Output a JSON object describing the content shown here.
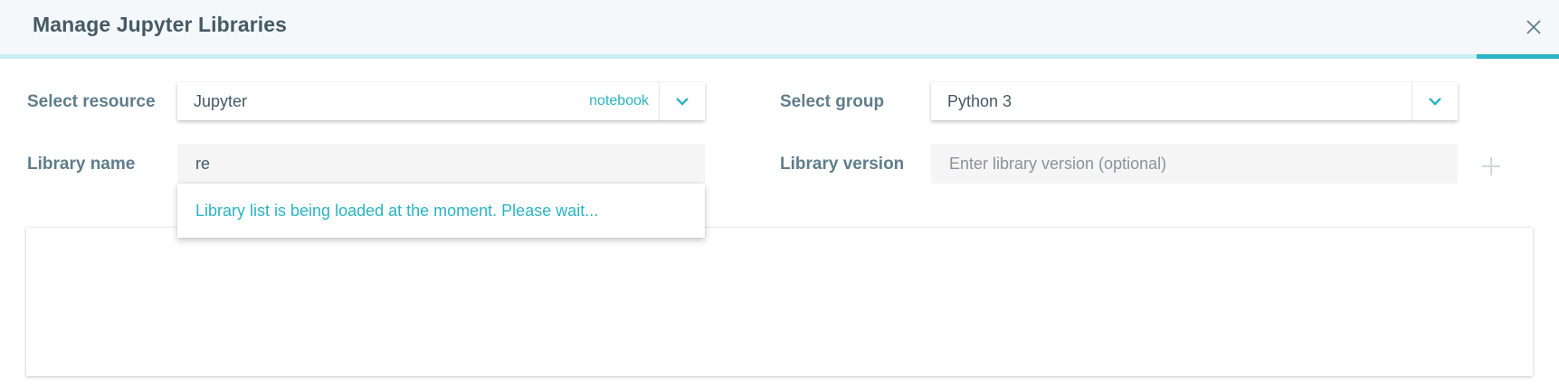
{
  "dialog": {
    "title": "Manage Jupyter Libraries"
  },
  "resource": {
    "label": "Select resource",
    "value": "Jupyter",
    "tag": "notebook"
  },
  "group": {
    "label": "Select group",
    "value": "Python 3"
  },
  "library_name": {
    "label": "Library name",
    "value": "re"
  },
  "library_version": {
    "label": "Library version",
    "placeholder": "Enter library version (optional)"
  },
  "autocomplete": {
    "message": "Library list is being loaded at the moment. Please wait..."
  },
  "colors": {
    "accent": "#2bb4c4",
    "header_bg": "#f5f8fb",
    "text": "#455a64",
    "label": "#607d8b"
  },
  "icons": {
    "close": "close-icon",
    "dropdown": "chevron-down-icon",
    "add": "plus-icon"
  }
}
